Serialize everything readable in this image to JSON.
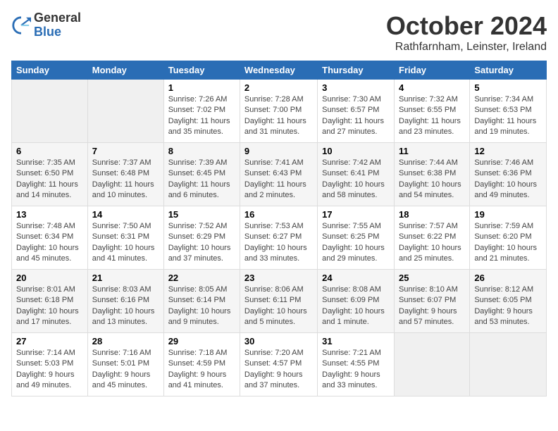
{
  "logo": {
    "general": "General",
    "blue": "Blue"
  },
  "header": {
    "month": "October 2024",
    "location": "Rathfarnham, Leinster, Ireland"
  },
  "weekdays": [
    "Sunday",
    "Monday",
    "Tuesday",
    "Wednesday",
    "Thursday",
    "Friday",
    "Saturday"
  ],
  "weeks": [
    [
      {
        "day": "",
        "info": ""
      },
      {
        "day": "",
        "info": ""
      },
      {
        "day": "1",
        "info": "Sunrise: 7:26 AM\nSunset: 7:02 PM\nDaylight: 11 hours and 35 minutes."
      },
      {
        "day": "2",
        "info": "Sunrise: 7:28 AM\nSunset: 7:00 PM\nDaylight: 11 hours and 31 minutes."
      },
      {
        "day": "3",
        "info": "Sunrise: 7:30 AM\nSunset: 6:57 PM\nDaylight: 11 hours and 27 minutes."
      },
      {
        "day": "4",
        "info": "Sunrise: 7:32 AM\nSunset: 6:55 PM\nDaylight: 11 hours and 23 minutes."
      },
      {
        "day": "5",
        "info": "Sunrise: 7:34 AM\nSunset: 6:53 PM\nDaylight: 11 hours and 19 minutes."
      }
    ],
    [
      {
        "day": "6",
        "info": "Sunrise: 7:35 AM\nSunset: 6:50 PM\nDaylight: 11 hours and 14 minutes."
      },
      {
        "day": "7",
        "info": "Sunrise: 7:37 AM\nSunset: 6:48 PM\nDaylight: 11 hours and 10 minutes."
      },
      {
        "day": "8",
        "info": "Sunrise: 7:39 AM\nSunset: 6:45 PM\nDaylight: 11 hours and 6 minutes."
      },
      {
        "day": "9",
        "info": "Sunrise: 7:41 AM\nSunset: 6:43 PM\nDaylight: 11 hours and 2 minutes."
      },
      {
        "day": "10",
        "info": "Sunrise: 7:42 AM\nSunset: 6:41 PM\nDaylight: 10 hours and 58 minutes."
      },
      {
        "day": "11",
        "info": "Sunrise: 7:44 AM\nSunset: 6:38 PM\nDaylight: 10 hours and 54 minutes."
      },
      {
        "day": "12",
        "info": "Sunrise: 7:46 AM\nSunset: 6:36 PM\nDaylight: 10 hours and 49 minutes."
      }
    ],
    [
      {
        "day": "13",
        "info": "Sunrise: 7:48 AM\nSunset: 6:34 PM\nDaylight: 10 hours and 45 minutes."
      },
      {
        "day": "14",
        "info": "Sunrise: 7:50 AM\nSunset: 6:31 PM\nDaylight: 10 hours and 41 minutes."
      },
      {
        "day": "15",
        "info": "Sunrise: 7:52 AM\nSunset: 6:29 PM\nDaylight: 10 hours and 37 minutes."
      },
      {
        "day": "16",
        "info": "Sunrise: 7:53 AM\nSunset: 6:27 PM\nDaylight: 10 hours and 33 minutes."
      },
      {
        "day": "17",
        "info": "Sunrise: 7:55 AM\nSunset: 6:25 PM\nDaylight: 10 hours and 29 minutes."
      },
      {
        "day": "18",
        "info": "Sunrise: 7:57 AM\nSunset: 6:22 PM\nDaylight: 10 hours and 25 minutes."
      },
      {
        "day": "19",
        "info": "Sunrise: 7:59 AM\nSunset: 6:20 PM\nDaylight: 10 hours and 21 minutes."
      }
    ],
    [
      {
        "day": "20",
        "info": "Sunrise: 8:01 AM\nSunset: 6:18 PM\nDaylight: 10 hours and 17 minutes."
      },
      {
        "day": "21",
        "info": "Sunrise: 8:03 AM\nSunset: 6:16 PM\nDaylight: 10 hours and 13 minutes."
      },
      {
        "day": "22",
        "info": "Sunrise: 8:05 AM\nSunset: 6:14 PM\nDaylight: 10 hours and 9 minutes."
      },
      {
        "day": "23",
        "info": "Sunrise: 8:06 AM\nSunset: 6:11 PM\nDaylight: 10 hours and 5 minutes."
      },
      {
        "day": "24",
        "info": "Sunrise: 8:08 AM\nSunset: 6:09 PM\nDaylight: 10 hours and 1 minute."
      },
      {
        "day": "25",
        "info": "Sunrise: 8:10 AM\nSunset: 6:07 PM\nDaylight: 9 hours and 57 minutes."
      },
      {
        "day": "26",
        "info": "Sunrise: 8:12 AM\nSunset: 6:05 PM\nDaylight: 9 hours and 53 minutes."
      }
    ],
    [
      {
        "day": "27",
        "info": "Sunrise: 7:14 AM\nSunset: 5:03 PM\nDaylight: 9 hours and 49 minutes."
      },
      {
        "day": "28",
        "info": "Sunrise: 7:16 AM\nSunset: 5:01 PM\nDaylight: 9 hours and 45 minutes."
      },
      {
        "day": "29",
        "info": "Sunrise: 7:18 AM\nSunset: 4:59 PM\nDaylight: 9 hours and 41 minutes."
      },
      {
        "day": "30",
        "info": "Sunrise: 7:20 AM\nSunset: 4:57 PM\nDaylight: 9 hours and 37 minutes."
      },
      {
        "day": "31",
        "info": "Sunrise: 7:21 AM\nSunset: 4:55 PM\nDaylight: 9 hours and 33 minutes."
      },
      {
        "day": "",
        "info": ""
      },
      {
        "day": "",
        "info": ""
      }
    ]
  ]
}
